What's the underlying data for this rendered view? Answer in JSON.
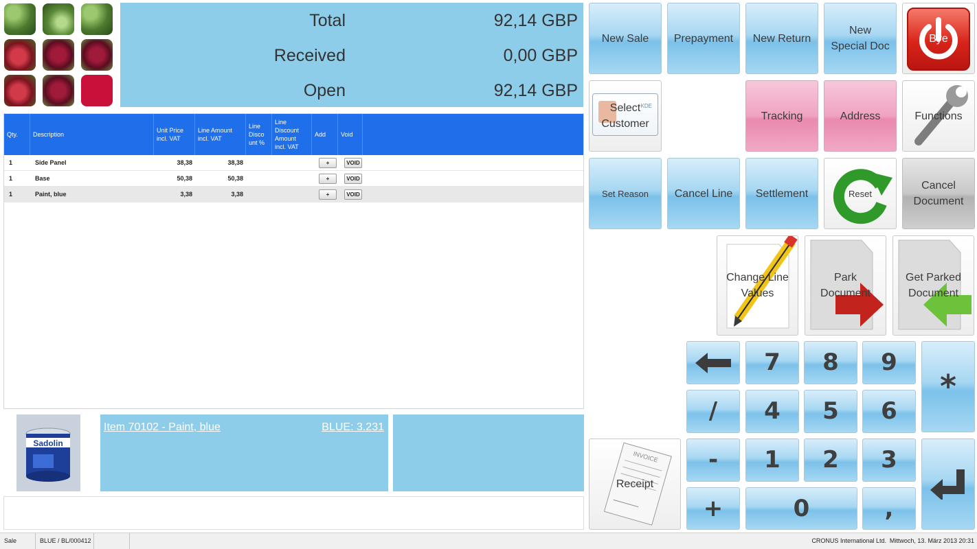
{
  "totals": {
    "rows": [
      {
        "label": "Total",
        "value": "92,14 GBP"
      },
      {
        "label": "Received",
        "value": "0,00 GBP"
      },
      {
        "label": "Open",
        "value": "92,14 GBP"
      }
    ]
  },
  "grid": {
    "columns": [
      "Qty.",
      "Description",
      "Unit Price incl. VAT",
      "Line Amount incl. VAT",
      "Line Disco unt %",
      "Line Discount Amount incl. VAT",
      "Add",
      "Void"
    ],
    "rows": [
      {
        "qty": "1",
        "description": "Side Panel",
        "unit_price": "38,38",
        "line_amount": "38,38",
        "add": "+",
        "void": "VOID"
      },
      {
        "qty": "1",
        "description": "Base",
        "unit_price": "50,38",
        "line_amount": "50,38",
        "add": "+",
        "void": "VOID"
      },
      {
        "qty": "1",
        "description": "Paint, blue",
        "unit_price": "3,38",
        "line_amount": "3,38",
        "add": "+",
        "void": "VOID"
      }
    ]
  },
  "item": {
    "title": "Item 70102  -  Paint, blue",
    "stock": "BLUE: 3.231"
  },
  "buttons": {
    "new_sale": "New Sale",
    "prepayment": "Prepayment",
    "new_return": "New Return",
    "new_special_doc": "New Special Doc",
    "bye": "Bye",
    "select_customer": "Select Customer",
    "tracking": "Tracking",
    "address": "Address",
    "functions": "Functions",
    "set_reason": "Set Reason",
    "cancel_line": "Cancel Line",
    "settlement": "Settlement",
    "reset": "Reset",
    "cancel_document": "Cancel Document",
    "change_line_values": "Change Line Values",
    "park_document": "Park Document",
    "get_parked_document": "Get Parked Document",
    "receipt": "Receipt"
  },
  "keypad": {
    "seven": "7",
    "eight": "8",
    "nine": "9",
    "four": "4",
    "five": "5",
    "six": "6",
    "one": "1",
    "two": "2",
    "three": "3",
    "zero": "0",
    "comma": ",",
    "slash": "/",
    "minus": "-",
    "plus": "+",
    "star": "*"
  },
  "status": {
    "mode": "Sale",
    "document": "BLUE / BL/000412",
    "company": "CRONUS International Ltd.",
    "datetime": "Mittwoch, 13. März 2013 20:31"
  },
  "colors": {
    "panel_blue": "#8dcde9",
    "grid_header": "#1f6fea",
    "pink": "#f0a3c1"
  }
}
